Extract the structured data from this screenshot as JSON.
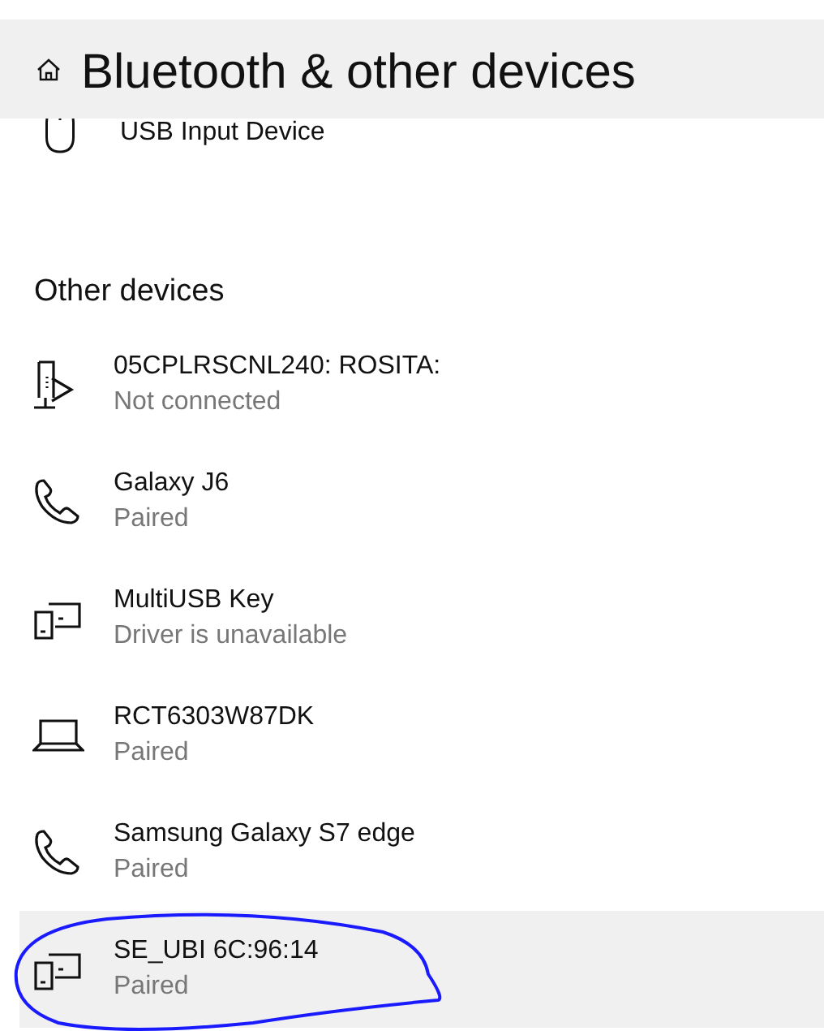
{
  "header": {
    "title": "Bluetooth & other devices"
  },
  "top_device": {
    "kind": "mouse",
    "name": "USB Input Device"
  },
  "other_devices": {
    "heading": "Other devices",
    "items": [
      {
        "kind": "media",
        "name": "05CPLRSCNL240: ROSITA:",
        "status": "Not connected",
        "selected": false
      },
      {
        "kind": "phone",
        "name": "Galaxy J6",
        "status": "Paired",
        "selected": false
      },
      {
        "kind": "devices",
        "name": "MultiUSB Key",
        "status": "Driver is unavailable",
        "selected": false
      },
      {
        "kind": "laptop",
        "name": "RCT6303W87DK",
        "status": "Paired",
        "selected": false
      },
      {
        "kind": "phone",
        "name": "Samsung Galaxy S7 edge",
        "status": "Paired",
        "selected": false
      },
      {
        "kind": "devices",
        "name": "SE_UBI 6C:96:14",
        "status": "Paired",
        "selected": true
      }
    ]
  }
}
